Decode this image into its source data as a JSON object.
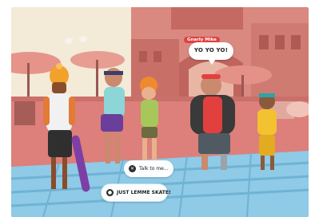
{
  "dialogue": {
    "speaker_name": "Gnarly Mike",
    "line": "YO YO YO!"
  },
  "choices": [
    {
      "icon": "close-icon",
      "glyph": "✕",
      "label": "Talk to me..."
    },
    {
      "icon": "radio-icon",
      "glyph": "●",
      "label": "JUST LEMME SKATE!"
    }
  ],
  "colors": {
    "sky": "#f3ead7",
    "ground": "#dd7f7a",
    "building": "#c46a63",
    "water": "#8fcae6",
    "nametag": "#e2403f"
  }
}
